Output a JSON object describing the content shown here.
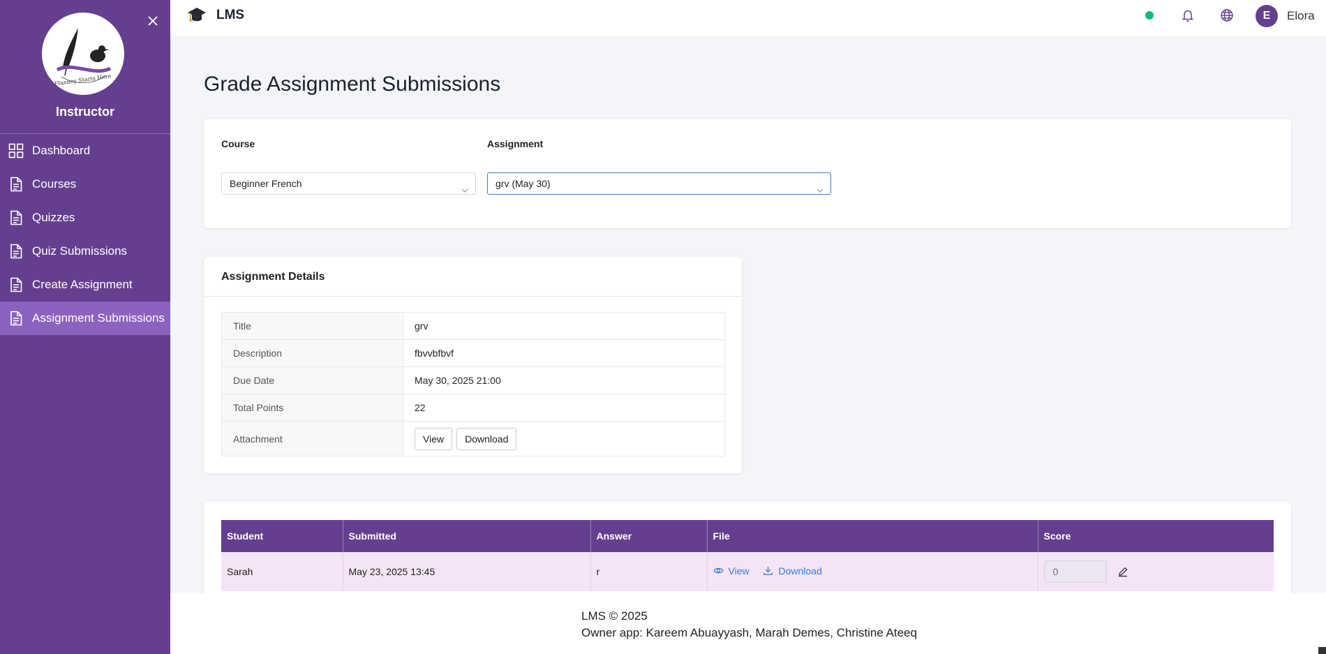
{
  "app": {
    "name": "LMS"
  },
  "sidebar": {
    "role": "Instructor",
    "items": [
      {
        "label": "Dashboard",
        "icon": "grid-icon"
      },
      {
        "label": "Courses",
        "icon": "document-icon"
      },
      {
        "label": "Quizzes",
        "icon": "document-icon"
      },
      {
        "label": "Quiz Submissions",
        "icon": "document-icon"
      },
      {
        "label": "Create Assignment",
        "icon": "document-icon"
      },
      {
        "label": "Assignment Submissions",
        "icon": "document-icon",
        "active": true
      }
    ],
    "close_icon": "close-icon",
    "logo_text": "Fluency Starts Here"
  },
  "topbar": {
    "status_color": "#10b981",
    "avatar_initial": "E",
    "username": "Elora"
  },
  "page": {
    "title": "Grade Assignment Submissions"
  },
  "filters": {
    "course_label": "Course",
    "course_value": "Beginner French",
    "assignment_label": "Assignment",
    "assignment_value": "grv (May 30)"
  },
  "details": {
    "header": "Assignment Details",
    "rows": [
      {
        "key": "Title",
        "value": "grv"
      },
      {
        "key": "Description",
        "value": "fbvvbfbvf"
      },
      {
        "key": "Due Date",
        "value": "May 30, 2025 21:00"
      },
      {
        "key": "Total Points",
        "value": "22"
      }
    ],
    "attachment_label": "Attachment",
    "view_label": "View",
    "download_label": "Download"
  },
  "submissions": {
    "columns": [
      "Student",
      "Submitted",
      "Answer",
      "File",
      "Score"
    ],
    "rows": [
      {
        "student": "Sarah",
        "submitted": "May 23, 2025 13:45",
        "answer": "r",
        "view": "View",
        "download": "Download",
        "score_placeholder": "0"
      }
    ]
  },
  "footer": {
    "line1": "LMS © 2025",
    "line2": "Owner app: Kareem Abuayyash, Marah Demes, Christine Ateeq"
  },
  "colors": {
    "primary": "#653f8f",
    "active": "#8b62c0",
    "link": "#3b7ad9",
    "row": "#f4e4f6"
  }
}
